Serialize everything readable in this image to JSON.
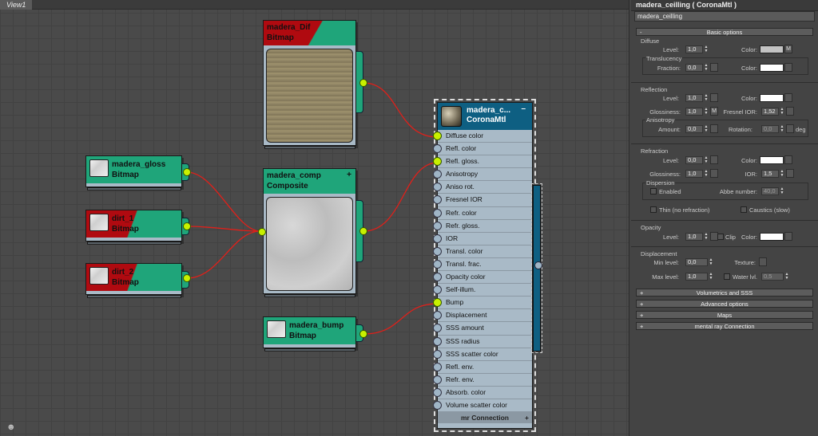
{
  "viewport": {
    "tab_label": "View1",
    "corner_icon": "binoculars-icon"
  },
  "nodes": {
    "madera_dif": {
      "name": "madera_Dif",
      "type": "Bitmap"
    },
    "madera_gloss": {
      "name": "madera_gloss",
      "type": "Bitmap"
    },
    "dirt_1": {
      "name": "dirt_1",
      "type": "Bitmap"
    },
    "dirt_2": {
      "name": "dirt_2",
      "type": "Bitmap"
    },
    "madera_comp": {
      "name": "madera_comp",
      "type": "Composite",
      "expand": "+"
    },
    "madera_bump": {
      "name": "madera_bump",
      "type": "Bitmap"
    },
    "corona": {
      "name": "madera_c...",
      "type": "CoronaMtl",
      "collapse": "–",
      "slots": [
        "Diffuse color",
        "Refl. color",
        "Refl. gloss.",
        "Anisotropy",
        "Aniso rot.",
        "Fresnel IOR",
        "Refr. color",
        "Refr. gloss.",
        "IOR",
        "Transl. color",
        "Transl. frac.",
        "Opacity color",
        "Self-illum.",
        "Bump",
        "Displacement",
        "SSS amount",
        "SSS radius",
        "SSS scatter color",
        "Refl. env.",
        "Refr. env.",
        "Absorb. color",
        "Volume scatter color"
      ],
      "connected_slots": [
        "Diffuse color",
        "Refl. gloss.",
        "Bump"
      ],
      "footer": "mr Connection",
      "footer_sign": "+"
    }
  },
  "panel": {
    "title": "madera_ceilling  ( CoronaMtl )",
    "material_name": "madera_ceilling",
    "basic_options": {
      "label": "Basic options",
      "sign": "-"
    },
    "diffuse": {
      "title": "Diffuse",
      "level_label": "Level:",
      "level": "1,0",
      "color_label": "Color:",
      "color": "#c3c3c3",
      "map_btn": "M",
      "translucency_title": "Translucency",
      "fraction_label": "Fraction:",
      "fraction": "0,0",
      "transl_color_label": "Color:",
      "transl_color": "#ffffff"
    },
    "reflection": {
      "title": "Reflection",
      "level_label": "Level:",
      "level": "1,0",
      "color_label": "Color:",
      "color": "#ffffff",
      "gloss_label": "Glossiness:",
      "gloss": "1,0",
      "gloss_map": "M",
      "fresnel_label": "Fresnel IOR:",
      "fresnel": "1,52",
      "anisotropy_title": "Anisotropy",
      "amount_label": "Amount:",
      "amount": "0,0",
      "rotation_label": "Rotation:",
      "rotation": "0,0",
      "rotation_unit": "deg"
    },
    "refraction": {
      "title": "Refraction",
      "level_label": "Level:",
      "level": "0,0",
      "color_label": "Color:",
      "color": "#ffffff",
      "gloss_label": "Glossiness:",
      "gloss": "1,0",
      "ior_label": "IOR:",
      "ior": "1,5",
      "dispersion_title": "Dispersion",
      "enabled_label": "Enabled",
      "abbe_label": "Abbe number:",
      "abbe": "40,0",
      "thin_label": "Thin (no refraction)",
      "caustics_label": "Caustics (slow)"
    },
    "opacity": {
      "title": "Opacity",
      "level_label": "Level:",
      "level": "1,0",
      "clip_label": "Clip",
      "color_label": "Color:",
      "color": "#ffffff"
    },
    "displacement": {
      "title": "Displacement",
      "min_label": "Min level:",
      "min": "0,0",
      "texture_label": "Texture:",
      "max_label": "Max level:",
      "max": "1,0",
      "water_label": "Water lvl.",
      "water": "0,5"
    },
    "rollouts": [
      {
        "sign": "+",
        "label": "Volumetrics and SSS"
      },
      {
        "sign": "+",
        "label": "Advanced options"
      },
      {
        "sign": "+",
        "label": "Maps"
      },
      {
        "sign": "+",
        "label": "mental ray Connection"
      }
    ]
  }
}
